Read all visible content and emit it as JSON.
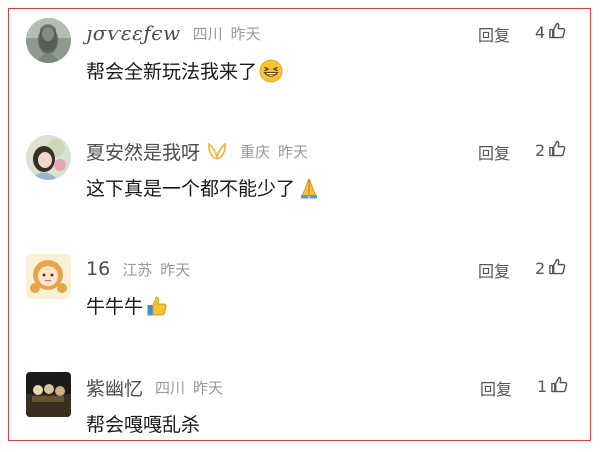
{
  "comments": [
    {
      "username": "ȷσѵεεƒєw",
      "location": "四川",
      "time": "昨天",
      "reply_label": "回复",
      "likes": "4",
      "text": "帮会全新玩法我来了",
      "emoji": "grinning-squint-face"
    },
    {
      "username": "夏安然是我呀",
      "badge": "yellow-ribbon-badge",
      "location": "重庆",
      "time": "昨天",
      "reply_label": "回复",
      "likes": "2",
      "text": "这下真是一个都不能少了",
      "emoji": "folded-hands"
    },
    {
      "username": "16",
      "location": "江苏",
      "time": "昨天",
      "reply_label": "回复",
      "likes": "2",
      "text": "牛牛牛",
      "emoji": "thumbs-up"
    },
    {
      "username": "紫幽忆",
      "location": "四川",
      "time": "昨天",
      "reply_label": "回复",
      "likes": "1",
      "text": "帮会嘎嘎乱杀"
    }
  ],
  "colors": {
    "frame_border": "#e23b3b",
    "meta_gray": "#9a9a9a",
    "username_gray": "#4d4d4d",
    "text": "#1a1a1a"
  }
}
